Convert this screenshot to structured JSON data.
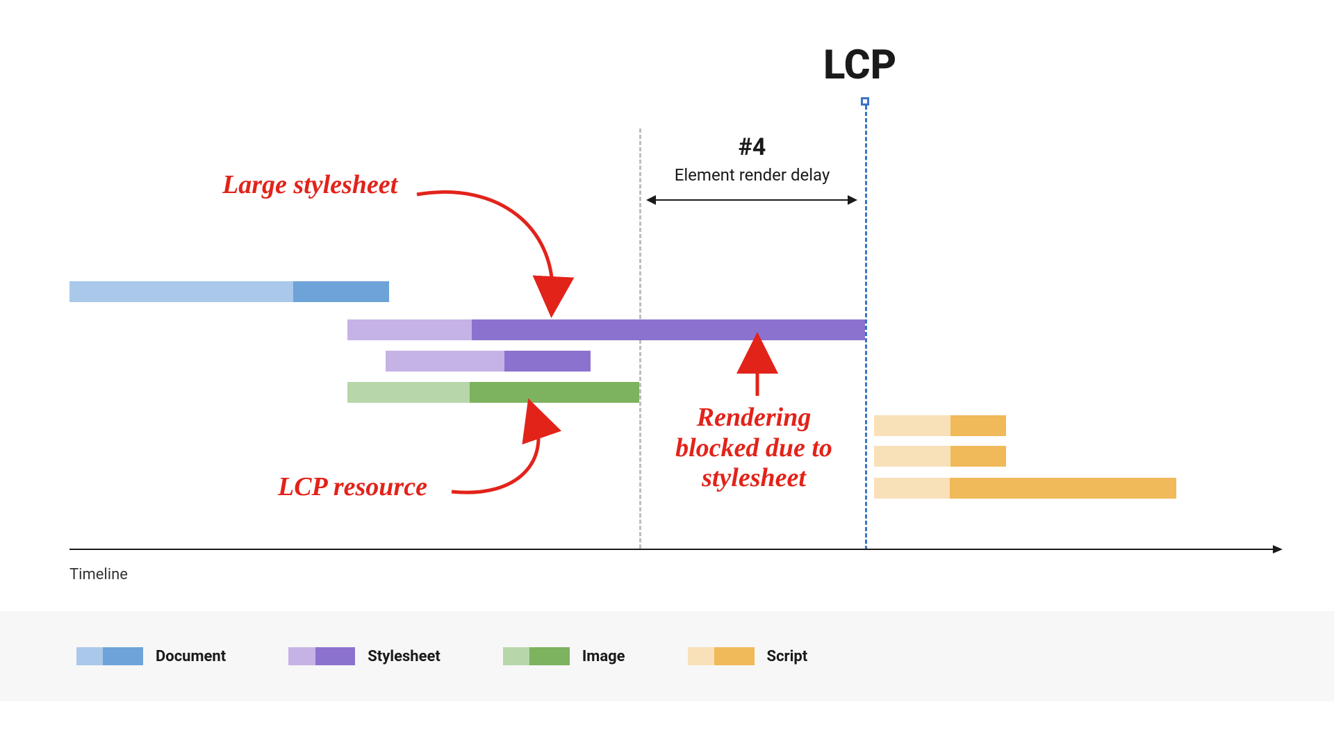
{
  "title": "LCP",
  "phase": {
    "num": "#4",
    "label": "Element render delay"
  },
  "axis_label": "Timeline",
  "annotations": {
    "large_stylesheet": "Large stylesheet",
    "lcp_resource": "LCP resource",
    "rendering_blocked": "Rendering\nblocked due to\nstylesheet"
  },
  "legend": [
    {
      "name": "Document",
      "light": "#a9c8ea",
      "dark": "#6ea3d9"
    },
    {
      "name": "Stylesheet",
      "light": "#c6b3e6",
      "dark": "#8c72cf"
    },
    {
      "name": "Image",
      "light": "#b7d6a9",
      "dark": "#7db25f"
    },
    {
      "name": "Script",
      "light": "#f8e0b8",
      "dark": "#f0b95a"
    }
  ],
  "colors": {
    "doc_l": "#a9c8ea",
    "doc_d": "#6ea3d9",
    "sty_l": "#c6b3e6",
    "sty_d": "#8c72cf",
    "img_l": "#b7d6a9",
    "img_d": "#7db25f",
    "scr_l": "#f8e0b8",
    "scr_d": "#f0b95a",
    "red": "#e2231a"
  },
  "chart_data": {
    "type": "gantt-waterfall",
    "x_unit": "relative time (%)",
    "x_range": [
      0,
      100
    ],
    "markers": {
      "render_delay_start": 48,
      "lcp": 66
    },
    "phase_span": {
      "name": "#4 Element render delay",
      "start": 48,
      "end": 66
    },
    "bars": [
      {
        "row": 0,
        "type": "Document",
        "start": 0,
        "split": 19,
        "end": 26
      },
      {
        "row": 1,
        "type": "Stylesheet",
        "start": 22,
        "split": 32,
        "end": 66,
        "note": "Large stylesheet"
      },
      {
        "row": 2,
        "type": "Stylesheet",
        "start": 26,
        "split": 36,
        "end": 44
      },
      {
        "row": 3,
        "type": "Image",
        "start": 22,
        "split": 32,
        "end": 48,
        "note": "LCP resource"
      },
      {
        "row": 4,
        "type": "Script",
        "start": 67,
        "split": 73,
        "end": 78
      },
      {
        "row": 5,
        "type": "Script",
        "start": 67,
        "split": 73,
        "end": 78
      },
      {
        "row": 6,
        "type": "Script",
        "start": 67,
        "split": 73,
        "end": 91
      }
    ],
    "annotations": [
      {
        "text": "Large stylesheet",
        "points_to": "bar[1]"
      },
      {
        "text": "LCP resource",
        "points_to": "bar[3]"
      },
      {
        "text": "Rendering blocked due to stylesheet",
        "points_to": "phase_span"
      }
    ]
  }
}
